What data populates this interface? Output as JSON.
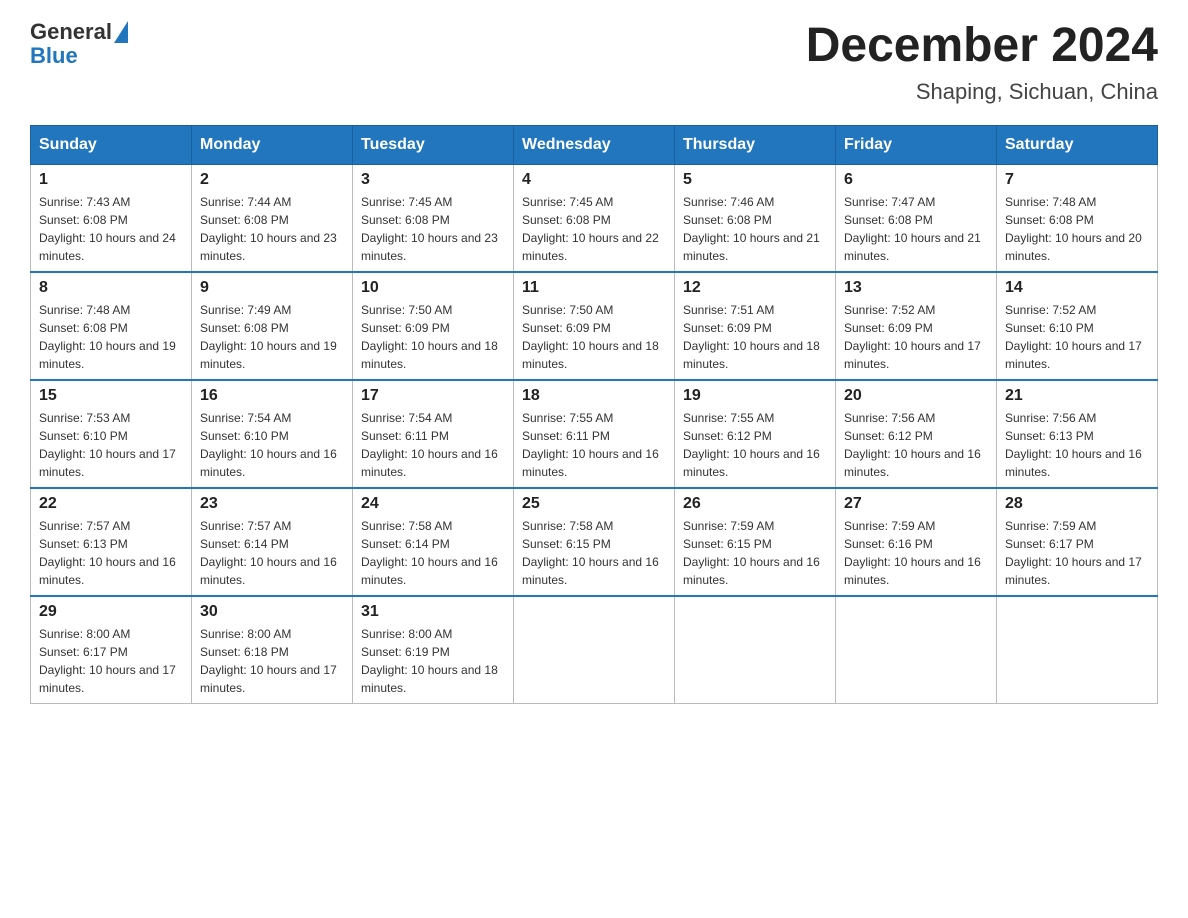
{
  "header": {
    "logo": {
      "text_general": "General",
      "text_blue": "Blue"
    },
    "title": "December 2024",
    "subtitle": "Shaping, Sichuan, China"
  },
  "calendar": {
    "weekdays": [
      "Sunday",
      "Monday",
      "Tuesday",
      "Wednesday",
      "Thursday",
      "Friday",
      "Saturday"
    ],
    "weeks": [
      [
        {
          "day": "1",
          "sunrise": "7:43 AM",
          "sunset": "6:08 PM",
          "daylight": "10 hours and 24 minutes."
        },
        {
          "day": "2",
          "sunrise": "7:44 AM",
          "sunset": "6:08 PM",
          "daylight": "10 hours and 23 minutes."
        },
        {
          "day": "3",
          "sunrise": "7:45 AM",
          "sunset": "6:08 PM",
          "daylight": "10 hours and 23 minutes."
        },
        {
          "day": "4",
          "sunrise": "7:45 AM",
          "sunset": "6:08 PM",
          "daylight": "10 hours and 22 minutes."
        },
        {
          "day": "5",
          "sunrise": "7:46 AM",
          "sunset": "6:08 PM",
          "daylight": "10 hours and 21 minutes."
        },
        {
          "day": "6",
          "sunrise": "7:47 AM",
          "sunset": "6:08 PM",
          "daylight": "10 hours and 21 minutes."
        },
        {
          "day": "7",
          "sunrise": "7:48 AM",
          "sunset": "6:08 PM",
          "daylight": "10 hours and 20 minutes."
        }
      ],
      [
        {
          "day": "8",
          "sunrise": "7:48 AM",
          "sunset": "6:08 PM",
          "daylight": "10 hours and 19 minutes."
        },
        {
          "day": "9",
          "sunrise": "7:49 AM",
          "sunset": "6:08 PM",
          "daylight": "10 hours and 19 minutes."
        },
        {
          "day": "10",
          "sunrise": "7:50 AM",
          "sunset": "6:09 PM",
          "daylight": "10 hours and 18 minutes."
        },
        {
          "day": "11",
          "sunrise": "7:50 AM",
          "sunset": "6:09 PM",
          "daylight": "10 hours and 18 minutes."
        },
        {
          "day": "12",
          "sunrise": "7:51 AM",
          "sunset": "6:09 PM",
          "daylight": "10 hours and 18 minutes."
        },
        {
          "day": "13",
          "sunrise": "7:52 AM",
          "sunset": "6:09 PM",
          "daylight": "10 hours and 17 minutes."
        },
        {
          "day": "14",
          "sunrise": "7:52 AM",
          "sunset": "6:10 PM",
          "daylight": "10 hours and 17 minutes."
        }
      ],
      [
        {
          "day": "15",
          "sunrise": "7:53 AM",
          "sunset": "6:10 PM",
          "daylight": "10 hours and 17 minutes."
        },
        {
          "day": "16",
          "sunrise": "7:54 AM",
          "sunset": "6:10 PM",
          "daylight": "10 hours and 16 minutes."
        },
        {
          "day": "17",
          "sunrise": "7:54 AM",
          "sunset": "6:11 PM",
          "daylight": "10 hours and 16 minutes."
        },
        {
          "day": "18",
          "sunrise": "7:55 AM",
          "sunset": "6:11 PM",
          "daylight": "10 hours and 16 minutes."
        },
        {
          "day": "19",
          "sunrise": "7:55 AM",
          "sunset": "6:12 PM",
          "daylight": "10 hours and 16 minutes."
        },
        {
          "day": "20",
          "sunrise": "7:56 AM",
          "sunset": "6:12 PM",
          "daylight": "10 hours and 16 minutes."
        },
        {
          "day": "21",
          "sunrise": "7:56 AM",
          "sunset": "6:13 PM",
          "daylight": "10 hours and 16 minutes."
        }
      ],
      [
        {
          "day": "22",
          "sunrise": "7:57 AM",
          "sunset": "6:13 PM",
          "daylight": "10 hours and 16 minutes."
        },
        {
          "day": "23",
          "sunrise": "7:57 AM",
          "sunset": "6:14 PM",
          "daylight": "10 hours and 16 minutes."
        },
        {
          "day": "24",
          "sunrise": "7:58 AM",
          "sunset": "6:14 PM",
          "daylight": "10 hours and 16 minutes."
        },
        {
          "day": "25",
          "sunrise": "7:58 AM",
          "sunset": "6:15 PM",
          "daylight": "10 hours and 16 minutes."
        },
        {
          "day": "26",
          "sunrise": "7:59 AM",
          "sunset": "6:15 PM",
          "daylight": "10 hours and 16 minutes."
        },
        {
          "day": "27",
          "sunrise": "7:59 AM",
          "sunset": "6:16 PM",
          "daylight": "10 hours and 16 minutes."
        },
        {
          "day": "28",
          "sunrise": "7:59 AM",
          "sunset": "6:17 PM",
          "daylight": "10 hours and 17 minutes."
        }
      ],
      [
        {
          "day": "29",
          "sunrise": "8:00 AM",
          "sunset": "6:17 PM",
          "daylight": "10 hours and 17 minutes."
        },
        {
          "day": "30",
          "sunrise": "8:00 AM",
          "sunset": "6:18 PM",
          "daylight": "10 hours and 17 minutes."
        },
        {
          "day": "31",
          "sunrise": "8:00 AM",
          "sunset": "6:19 PM",
          "daylight": "10 hours and 18 minutes."
        },
        null,
        null,
        null,
        null
      ]
    ]
  }
}
